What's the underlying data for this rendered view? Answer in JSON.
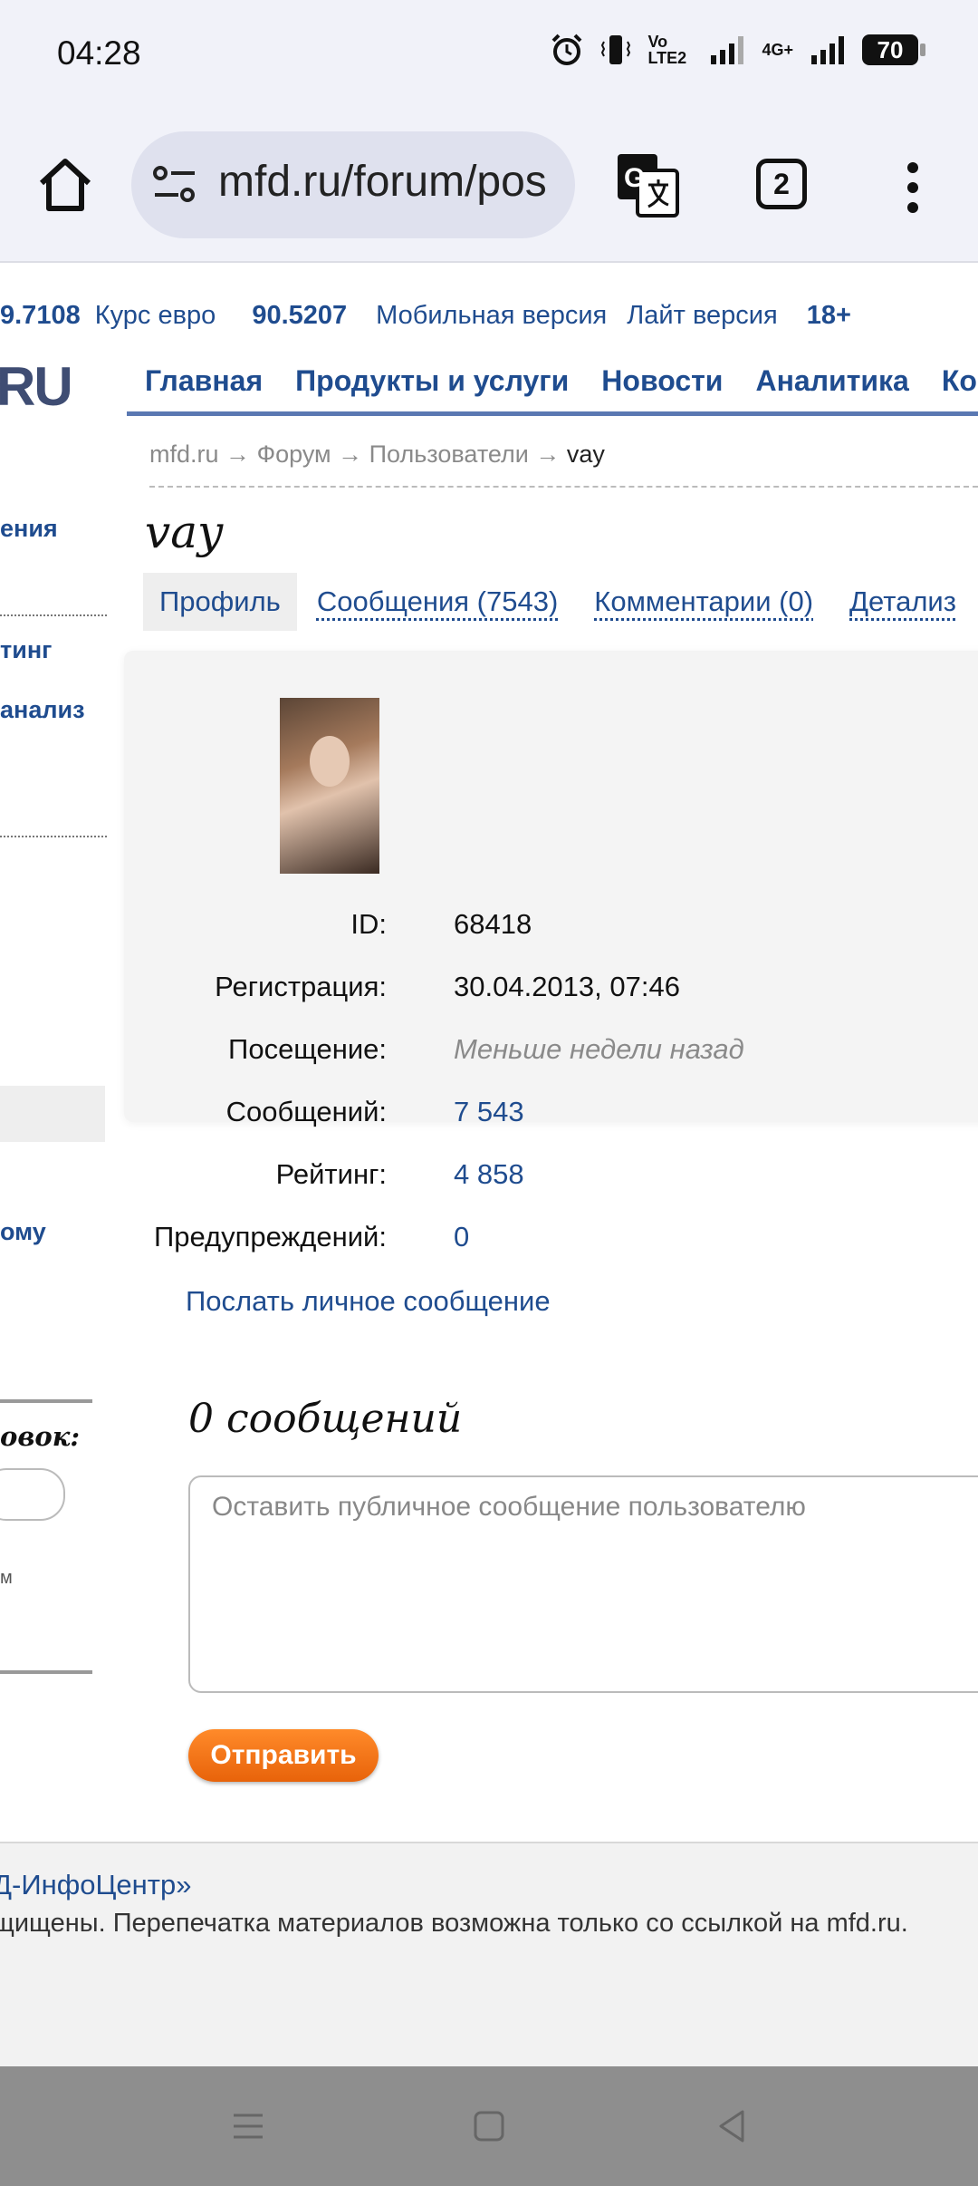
{
  "status_bar": {
    "time": "04:28",
    "icons": [
      "alarm-icon",
      "vibrate-icon",
      "volte-icon",
      "signal-icon",
      "4g-signal-icon"
    ],
    "network": "Vo LTE2",
    "network2": "4G+",
    "battery": "70"
  },
  "browser": {
    "url": "mfd.ru/forum/pos",
    "tab_count": "2"
  },
  "page": {
    "rates": {
      "usd_fragment": "9.7108",
      "euro_label": "Курс евро",
      "euro_value": "90.5207",
      "mobile": "Мобильная версия",
      "lite": "Лайт версия",
      "age": "18+"
    },
    "logo": "RU",
    "nav": [
      "Главная",
      "Продукты и услуги",
      "Новости",
      "Аналитика",
      "Ко"
    ],
    "breadcrumb": {
      "home": "mfd.ru",
      "forum": "Форум",
      "users": "Пользователи",
      "sep": "→",
      "current": "vay"
    },
    "username": "vay",
    "tabs": {
      "profile": "Профиль",
      "messages": "Сообщения (7543)",
      "comments": "Комментарии (0)",
      "details": "Детализ"
    },
    "sidebar": {
      "item1": "ения",
      "item2": "тинг",
      "item3": "анализ",
      "item4": "ому",
      "headline": "овок:",
      "small": "м"
    },
    "profile": {
      "id_label": "ID:",
      "id_value": "68418",
      "reg_label": "Регистрация:",
      "reg_value": "30.04.2013, 07:46",
      "visit_label": "Посещение:",
      "visit_value": "Меньше недели назад",
      "posts_label": "Сообщений:",
      "posts_value": "7 543",
      "rating_label": "Рейтинг:",
      "rating_value": "4 858",
      "warn_label": "Предупреждений:",
      "warn_value": "0",
      "pm_link": "Послать личное сообщение"
    },
    "messages": {
      "count_title": "0 сообщений",
      "placeholder": "Оставить публичное сообщение пользователю",
      "send": "Отправить"
    },
    "footer": {
      "company": "Д-ИнфоЦентр»",
      "copyright": "щищены. Перепечатка материалов возможна только со ссылкой на mfd.ru."
    }
  },
  "colors": {
    "link_blue": "#1f4c8f",
    "nav_line": "#5a78b2",
    "send_orange": "#f07419"
  }
}
